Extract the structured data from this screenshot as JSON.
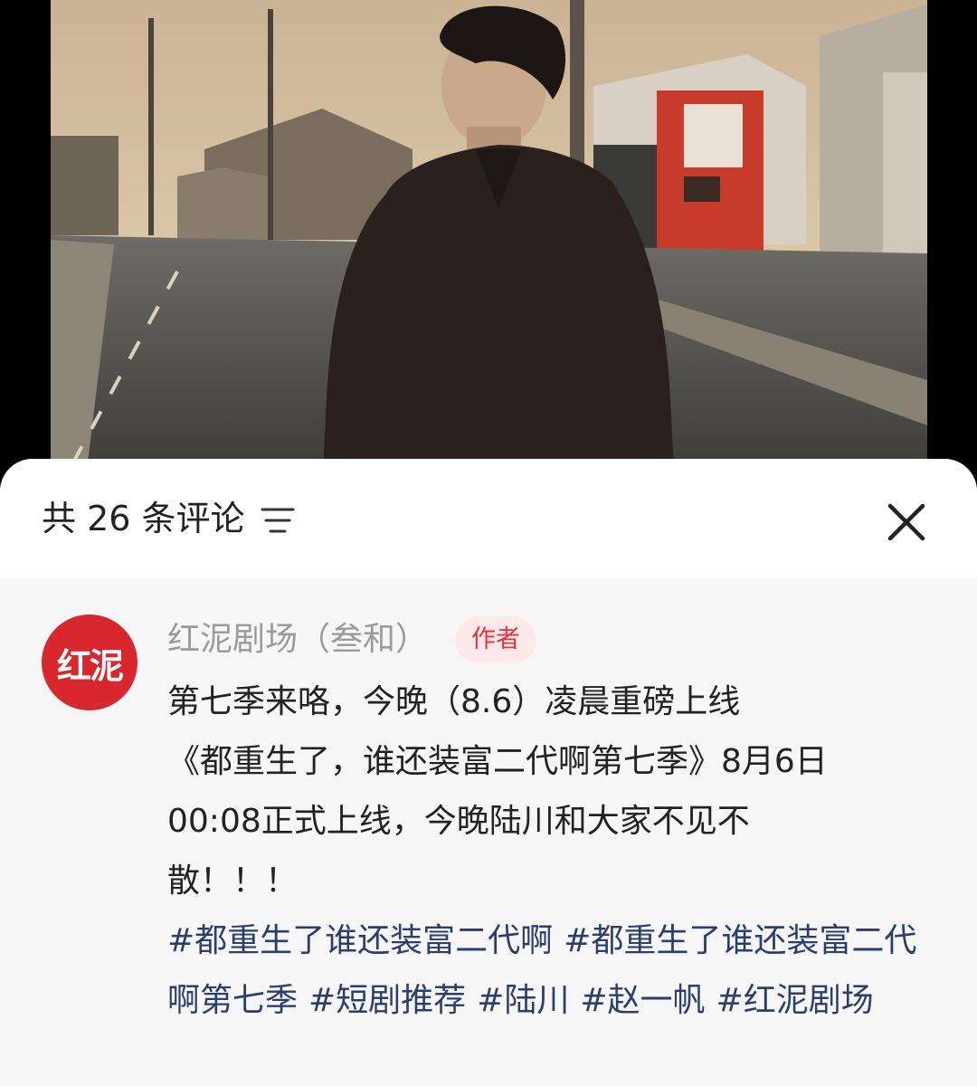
{
  "comments_panel": {
    "count_text": "共 26 条评论"
  },
  "comment": {
    "avatar_text": "红泥",
    "author": "红泥剧场（叁和）",
    "badge": "作者",
    "lines": [
      "第七季来咯，今晚（8.6）凌晨重磅上线",
      "《都重生了，谁还装富二代啊第七季》8月6日",
      "00:08正式上线，今晚陆川和大家不见不",
      "散！！！"
    ],
    "hashtags": [
      "#都重生了谁还装富二代啊",
      "#都重生了谁还装富二代啊第七季",
      "#短剧推荐",
      "#陆川",
      "#赵一帆",
      "#红泥剧场"
    ]
  },
  "colors": {
    "sheet_bg": "#ffffff",
    "comment_bg": "#f6f6f7",
    "hashtag": "#2b3e6e",
    "badge_text": "#e0353d",
    "badge_bg": "#fde9ea",
    "avatar_bg": "#d8282e"
  },
  "icons": {
    "sort": "sort-lines-icon",
    "close": "close-icon"
  }
}
